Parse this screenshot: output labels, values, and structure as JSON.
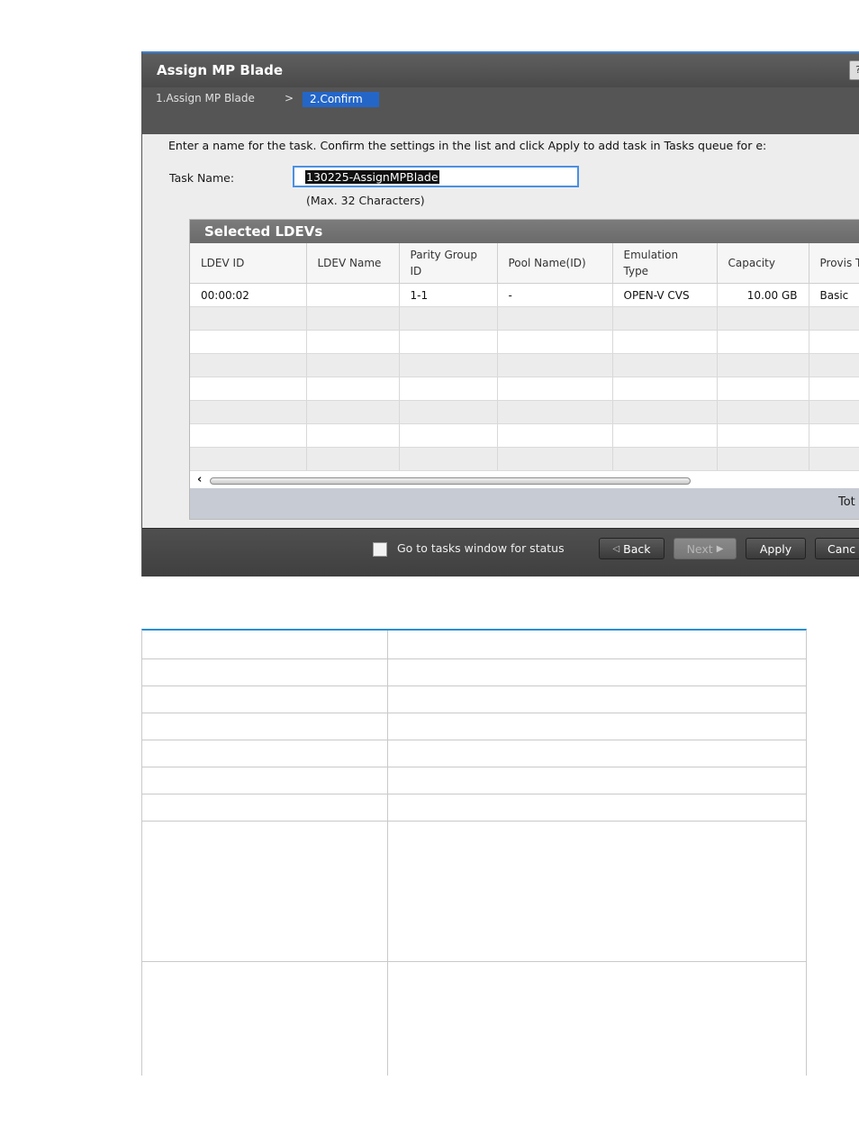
{
  "dialog": {
    "title": "Assign MP Blade",
    "help_label": "?",
    "steps": {
      "step1": "1.Assign MP Blade",
      "separator": ">",
      "step2": "2.Confirm"
    },
    "instruction": "Enter a name for the task. Confirm the settings in the list and click Apply to add task in Tasks queue for e:",
    "task_name": {
      "label": "Task Name:",
      "value": "130225-AssignMPBlade",
      "note": "(Max. 32 Characters)"
    },
    "panel": {
      "title": "Selected LDEVs",
      "columns": [
        "LDEV ID",
        "LDEV Name",
        "Parity Group ID",
        "Pool Name(ID)",
        "Emulation Type",
        "Capacity",
        "Provis Type"
      ],
      "rows": [
        [
          "00:00:02",
          "",
          "1-1",
          "-",
          "OPEN-V CVS",
          "10.00 GB",
          "Basic"
        ]
      ],
      "total_label": "Tot",
      "scroll_left": "‹"
    },
    "footer": {
      "checkbox_label": "Go to tasks window for status",
      "back": "Back",
      "next": "Next",
      "apply": "Apply",
      "cancel": "Canc"
    }
  },
  "colors": {
    "step_active": "#2466c8",
    "input_border": "#4a90e2",
    "desc_table_rule": "#2a8fd1"
  }
}
